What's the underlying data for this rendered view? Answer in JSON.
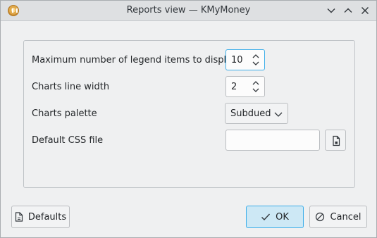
{
  "window": {
    "title": "Reports view — KMyMoney"
  },
  "form": {
    "legend_items": {
      "label": "Maximum number of legend items to display",
      "value": "10"
    },
    "line_width": {
      "label": "Charts line width",
      "value": "2"
    },
    "palette": {
      "label": "Charts palette",
      "value": "Subdued"
    },
    "css_file": {
      "label": "Default CSS file",
      "value": ""
    }
  },
  "buttons": {
    "defaults": "Defaults",
    "ok": "OK",
    "cancel": "Cancel"
  },
  "colors": {
    "accent": "#3daee9",
    "primary_button_bg": "#cde8f5",
    "titlebar_bg": "#dee0e2",
    "window_bg": "#eff0f1"
  },
  "icons": {
    "app": "kmymoney-app-icon",
    "minimize": "chevron-down-icon",
    "maximize": "chevron-up-icon",
    "close": "close-icon",
    "file": "document-open-icon",
    "defaults": "document-revert-icon",
    "ok": "check-icon",
    "cancel": "cancel-icon"
  }
}
